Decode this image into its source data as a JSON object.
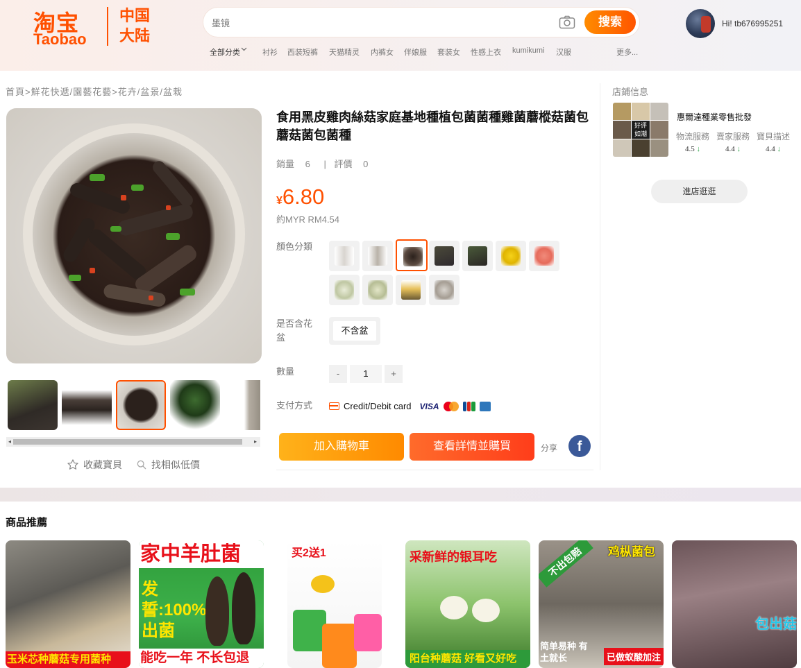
{
  "header": {
    "logo_cn": "淘宝",
    "logo_en": "Taobao",
    "logo_region": "中国大陆",
    "search_placeholder": "墨镜",
    "search_button": "搜索",
    "categories": [
      "全部分类",
      "衬衫",
      "西装短裤",
      "天猫精灵",
      "内裤女",
      "伴娘服",
      "套装女",
      "性感上衣",
      "kumikumi",
      "汉服",
      "更多..."
    ],
    "user_greeting": "Hi! tb676995251"
  },
  "breadcrumb": "首頁>鮮花快遞/園藝花藝>花卉/盆景/盆栽",
  "product": {
    "title": "食用黑皮雞肉絲菇家庭基地種植包菌菌種雞菌蘑樅菇菌包蘑菇菌包菌種",
    "sales_label": "銷量",
    "sales_value": "6",
    "separator": "|",
    "reviews_label": "評價",
    "reviews_value": "0",
    "currency": "¥",
    "price": "6.80",
    "price_myr": "約MYR RM4.54",
    "color_label": "顏色分類",
    "flowerpot_label": "是否含花盆",
    "flowerpot_option": "不含盆",
    "quantity_label": "數量",
    "quantity_minus": "-",
    "quantity_value": "1",
    "quantity_plus": "+",
    "payment_label": "支付方式",
    "payment_method": "Credit/Debit card",
    "visa": "VISA",
    "add_to_cart": "加入購物車",
    "buy_now": "查看詳情並購買",
    "share": "分享",
    "facebook": "f",
    "favorite": "收藏寶貝",
    "find_similar": "找相似低價"
  },
  "store": {
    "title": "店鋪信息",
    "badge": "好评如潮",
    "name": "惠爾達種業零售批發",
    "ratings": [
      {
        "label": "物流服務",
        "score": "4.5",
        "arrow": "↓"
      },
      {
        "label": "賣家服務",
        "score": "4.4",
        "arrow": "↓"
      },
      {
        "label": "寶貝描述",
        "score": "4.4",
        "arrow": "↓"
      }
    ],
    "visit_button": "進店逛逛"
  },
  "recommend": {
    "title": "商品推薦",
    "items": [
      {
        "caption": "玉米芯种蘑菇专用菌种"
      },
      {
        "caption_top": "家中羊肚菌",
        "caption_mid": "发誓:100%出菌",
        "caption": "能吃一年 不长包退"
      },
      {
        "caption_top": "买2送1"
      },
      {
        "caption_top": "采新鲜的银耳吃",
        "caption": "阳台种蘑菇 好看又好吃"
      },
      {
        "caption_top": "鸡枞菌包",
        "caption_corner": "不出包赔",
        "caption": "已做蚁酸加注",
        "caption_left": "简单易种 有土就长"
      },
      {
        "caption_mid": "包出菇"
      }
    ]
  },
  "colors": {
    "accent": "#ff5000",
    "price": "#ff5000",
    "rating_arrow": "#2ba245"
  },
  "icons": [
    "camera-icon",
    "chevron-down-icon",
    "star-icon",
    "search-icon",
    "card-icon",
    "facebook-icon"
  ]
}
